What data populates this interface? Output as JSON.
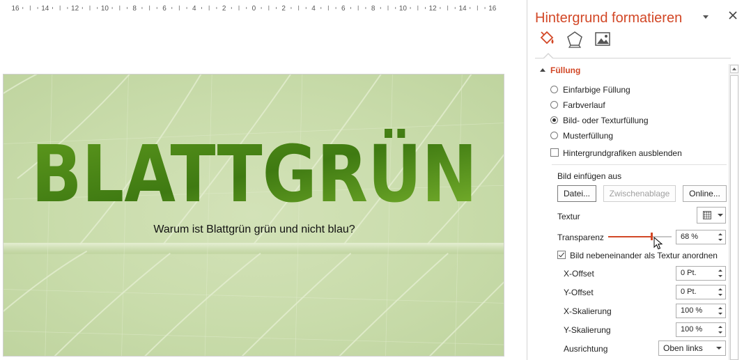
{
  "ruler": {
    "labels": [
      "16",
      "14",
      "12",
      "10",
      "8",
      "6",
      "4",
      "2",
      "0",
      "2",
      "4",
      "6",
      "8",
      "10",
      "12",
      "14",
      "16"
    ]
  },
  "slide": {
    "title": "BLATTGRÜN",
    "subtitle": "Warum ist Blattgrün grün und nicht blau?"
  },
  "pane": {
    "title": "Hintergrund formatieren",
    "tabs": [
      "fill-icon",
      "effects-pentagon-icon",
      "picture-icon"
    ],
    "section": "Füllung",
    "fill_options": [
      {
        "label": "Einfarbige Füllung",
        "checked": false
      },
      {
        "label": "Farbverlauf",
        "checked": false
      },
      {
        "label": "Bild- oder Texturfüllung",
        "checked": true
      },
      {
        "label": "Musterfüllung",
        "checked": false
      }
    ],
    "hide_graphics": {
      "label": "Hintergrundgrafiken ausblenden",
      "checked": false
    },
    "insert_label": "Bild einfügen aus",
    "buttons": {
      "file": "Datei...",
      "clipboard": "Zwischenablage",
      "online": "Online..."
    },
    "texture_label": "Textur",
    "transparency": {
      "label": "Transparenz",
      "value": "68 %",
      "level": 0.68
    },
    "tile": {
      "label": "Bild nebeneinander als Textur anordnen",
      "checked": true
    },
    "offset_x": {
      "label": "X-Offset",
      "value": "0 Pt."
    },
    "offset_y": {
      "label": "Y-Offset",
      "value": "0 Pt."
    },
    "scale_x": {
      "label": "X-Skalierung",
      "value": "100 %"
    },
    "scale_y": {
      "label": "Y-Skalierung",
      "value": "100 %"
    },
    "alignment": {
      "label": "Ausrichtung",
      "value": "Oben links"
    }
  },
  "colors": {
    "accent": "#d24726",
    "leaf_light": "#d3e2b8",
    "leaf_dark": "#3f7a12"
  }
}
